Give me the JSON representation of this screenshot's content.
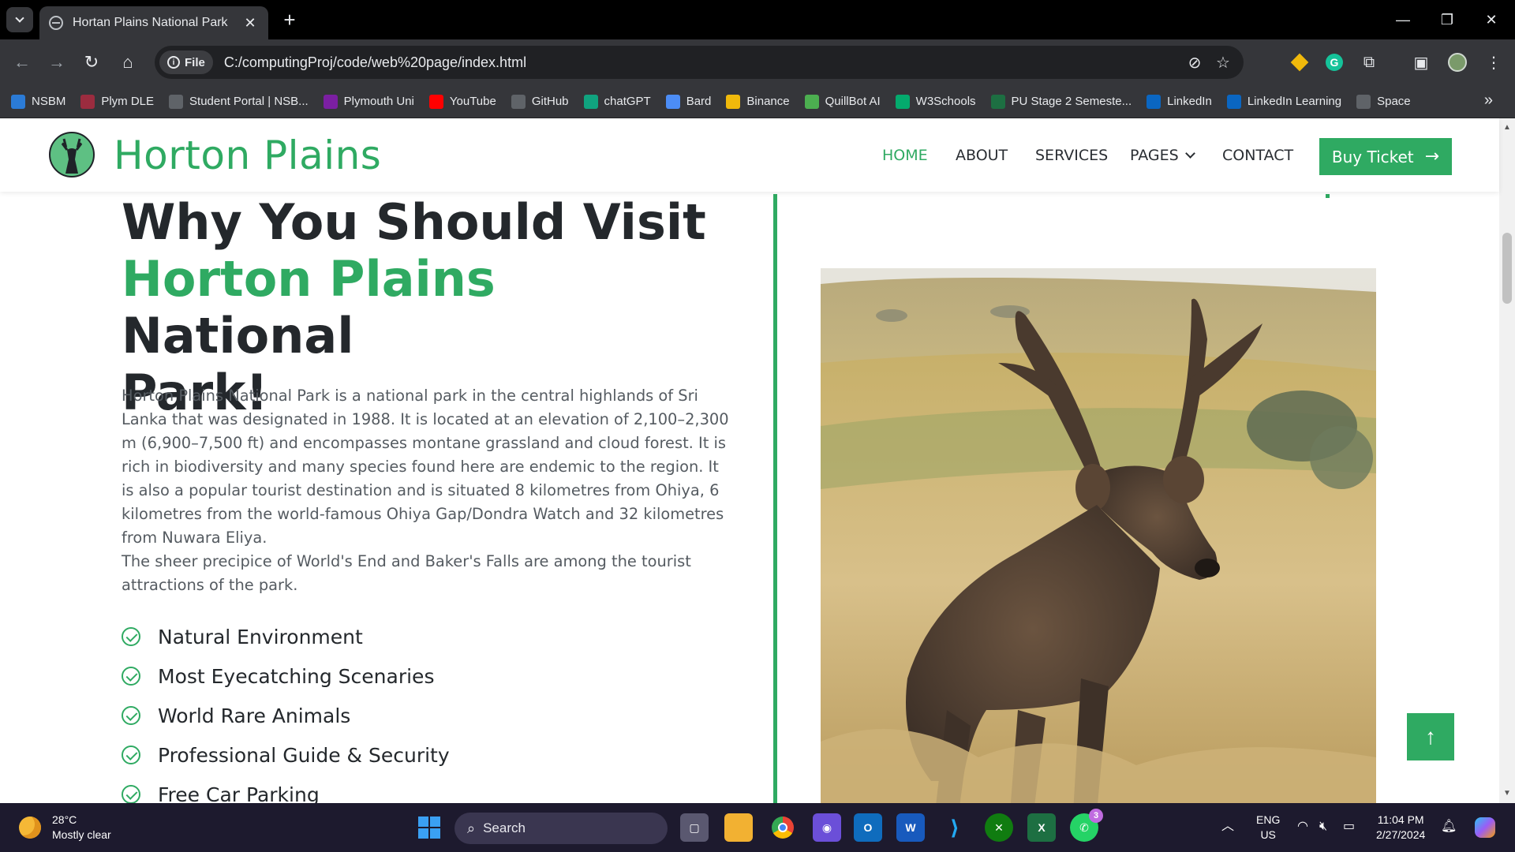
{
  "browser": {
    "tab_title": "Hortan Plains National Park",
    "file_chip": "File",
    "url": "C:/computingProj/code/web%20page/index.html"
  },
  "bookmarks": [
    {
      "label": "NSBM",
      "color": "#2b7bd6"
    },
    {
      "label": "Plym DLE",
      "color": "#9b2c3f"
    },
    {
      "label": "Student Portal | NSB...",
      "color": "#5f6368"
    },
    {
      "label": "Plymouth Uni",
      "color": "#7b1fa2"
    },
    {
      "label": "YouTube",
      "color": "#ff0000"
    },
    {
      "label": "GitHub",
      "color": "#5f6368"
    },
    {
      "label": "chatGPT",
      "color": "#10a37f"
    },
    {
      "label": "Bard",
      "color": "#4c8df6"
    },
    {
      "label": "Binance",
      "color": "#f0b90b"
    },
    {
      "label": "QuillBot AI",
      "color": "#4caf50"
    },
    {
      "label": "W3Schools",
      "color": "#04aa6d"
    },
    {
      "label": "PU Stage 2 Semeste...",
      "color": "#1d6f42"
    },
    {
      "label": "LinkedIn",
      "color": "#0a66c2"
    },
    {
      "label": "LinkedIn Learning",
      "color": "#0a66c2"
    },
    {
      "label": "Space",
      "color": "#5f6368"
    }
  ],
  "site": {
    "brand": "Horton Plains",
    "nav": [
      "HOME",
      "ABOUT",
      "SERVICES",
      "PAGES",
      "CONTACT"
    ],
    "buy_label": "Buy Ticket",
    "headline_1": "Why You Should Visit",
    "headline_green": "Horton Plains",
    "headline_2": "National",
    "headline_3": "Park!",
    "paragraph_1": "Horton Plains National Park is a national park in the central highlands of Sri Lanka that was designated in 1988. It is located at an elevation of 2,100–2,300 m (6,900–7,500 ft) and encompasses montane grassland and cloud forest. It is rich in biodiversity and many species found here are endemic to the region. It is also a popular tourist destination and is situated 8 kilometres from Ohiya, 6 kilometres from the world-famous Ohiya Gap/Dondra Watch and 32 kilometres from Nuwara Eliya.",
    "paragraph_2": "The sheer precipice of World's End and Baker's Falls are among the tourist attractions of the park.",
    "features": [
      "Natural Environment",
      "Most Eyecatching Scenaries",
      "World Rare Animals",
      "Professional Guide & Security",
      "Free Car Parking"
    ],
    "accent_color": "#2faa62"
  },
  "taskbar": {
    "temperature": "28°C",
    "weather": "Mostly clear",
    "search": "Search",
    "lang_1": "ENG",
    "lang_2": "US",
    "time": "11:04 PM",
    "date": "2/27/2024",
    "whatsapp_badge": "3"
  }
}
